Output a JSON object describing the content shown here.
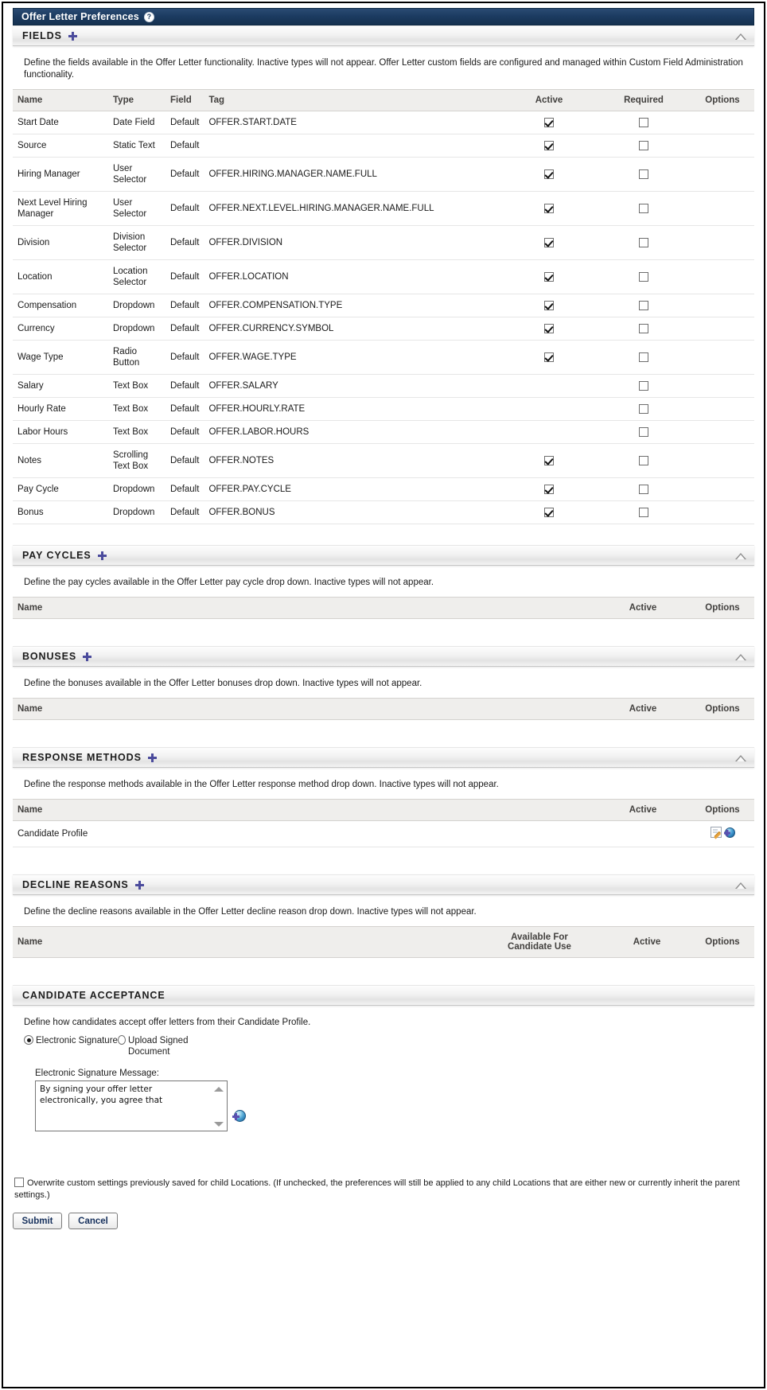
{
  "window": {
    "title": "Offer Letter Preferences",
    "help_badge": "?"
  },
  "sections": {
    "fields": {
      "heading": "FIELDS",
      "description": "Define the fields available in the Offer Letter functionality. Inactive types will not appear. Offer Letter custom fields are configured and managed within Custom Field Administration functionality.",
      "columns": {
        "name": "Name",
        "type": "Type",
        "field": "Field",
        "tag": "Tag",
        "active": "Active",
        "required": "Required",
        "options": "Options"
      },
      "rows": [
        {
          "name": "Start Date",
          "type": "Date Field",
          "field": "Default",
          "tag": "OFFER.START.DATE",
          "active": true,
          "required": false
        },
        {
          "name": "Source",
          "type": "Static Text",
          "field": "Default",
          "tag": "",
          "active": true,
          "required": false
        },
        {
          "name": "Hiring Manager",
          "type": "User Selector",
          "field": "Default",
          "tag": "OFFER.HIRING.MANAGER.NAME.FULL",
          "active": true,
          "required": false
        },
        {
          "name": "Next Level Hiring Manager",
          "type": "User Selector",
          "field": "Default",
          "tag": "OFFER.NEXT.LEVEL.HIRING.MANAGER.NAME.FULL",
          "active": true,
          "required": false
        },
        {
          "name": "Division",
          "type": "Division Selector",
          "field": "Default",
          "tag": "OFFER.DIVISION",
          "active": true,
          "required": false
        },
        {
          "name": "Location",
          "type": "Location Selector",
          "field": "Default",
          "tag": "OFFER.LOCATION",
          "active": true,
          "required": false
        },
        {
          "name": "Compensation",
          "type": "Dropdown",
          "field": "Default",
          "tag": "OFFER.COMPENSATION.TYPE",
          "active": true,
          "required": false
        },
        {
          "name": "Currency",
          "type": "Dropdown",
          "field": "Default",
          "tag": "OFFER.CURRENCY.SYMBOL",
          "active": true,
          "required": false
        },
        {
          "name": "Wage Type",
          "type": "Radio Button",
          "field": "Default",
          "tag": "OFFER.WAGE.TYPE",
          "active": true,
          "required": false
        },
        {
          "name": "Salary",
          "type": "Text Box",
          "field": "Default",
          "tag": "OFFER.SALARY",
          "active": null,
          "required": false
        },
        {
          "name": "Hourly Rate",
          "type": "Text Box",
          "field": "Default",
          "tag": "OFFER.HOURLY.RATE",
          "active": null,
          "required": false
        },
        {
          "name": "Labor Hours",
          "type": "Text Box",
          "field": "Default",
          "tag": "OFFER.LABOR.HOURS",
          "active": null,
          "required": false
        },
        {
          "name": "Notes",
          "type": "Scrolling Text Box",
          "field": "Default",
          "tag": "OFFER.NOTES",
          "active": true,
          "required": false
        },
        {
          "name": "Pay Cycle",
          "type": "Dropdown",
          "field": "Default",
          "tag": "OFFER.PAY.CYCLE",
          "active": true,
          "required": false
        },
        {
          "name": "Bonus",
          "type": "Dropdown",
          "field": "Default",
          "tag": "OFFER.BONUS",
          "active": true,
          "required": false
        }
      ]
    },
    "pay_cycles": {
      "heading": "PAY CYCLES",
      "description": "Define the pay cycles available in the Offer Letter pay cycle drop down. Inactive types will not appear.",
      "columns": {
        "name": "Name",
        "active": "Active",
        "options": "Options"
      },
      "rows": []
    },
    "bonuses": {
      "heading": "BONUSES",
      "description": "Define the bonuses available in the Offer Letter bonuses drop down. Inactive types will not appear.",
      "columns": {
        "name": "Name",
        "active": "Active",
        "options": "Options"
      },
      "rows": []
    },
    "response_methods": {
      "heading": "RESPONSE METHODS",
      "description": "Define the response methods available in the Offer Letter response method drop down. Inactive types will not appear.",
      "columns": {
        "name": "Name",
        "active": "Active",
        "options": "Options"
      },
      "rows": [
        {
          "name": "Candidate Profile",
          "active": null,
          "options": [
            "edit-icon",
            "globe-add-icon"
          ]
        }
      ]
    },
    "decline_reasons": {
      "heading": "DECLINE REASONS",
      "description": "Define the decline reasons available in the Offer Letter decline reason drop down. Inactive types will not appear.",
      "columns": {
        "name": "Name",
        "available_line1": "Available For",
        "available_line2": "Candidate Use",
        "active": "Active",
        "options": "Options"
      },
      "rows": []
    },
    "candidate_acceptance": {
      "heading": "CANDIDATE ACCEPTANCE",
      "description": "Define how candidates accept offer letters from their Candidate Profile.",
      "radio_options": [
        {
          "label": "Electronic Signature",
          "selected": true
        },
        {
          "label": "Upload Signed Document",
          "selected": false
        }
      ],
      "signature_label": "Electronic Signature Message:",
      "signature_value": "By signing your offer letter electronically, you agree that"
    }
  },
  "footer": {
    "overwrite_label": "Overwrite custom settings previously saved for child Locations. (If unchecked, the preferences will still be applied to any child Locations that are either new or currently inherit the parent settings.)",
    "overwrite_checked": false,
    "submit_label": "Submit",
    "cancel_label": "Cancel"
  },
  "colors": {
    "titlebar": "#1b3a60",
    "button_text": "#16305c",
    "plus_icon": "#4b4b9c"
  }
}
